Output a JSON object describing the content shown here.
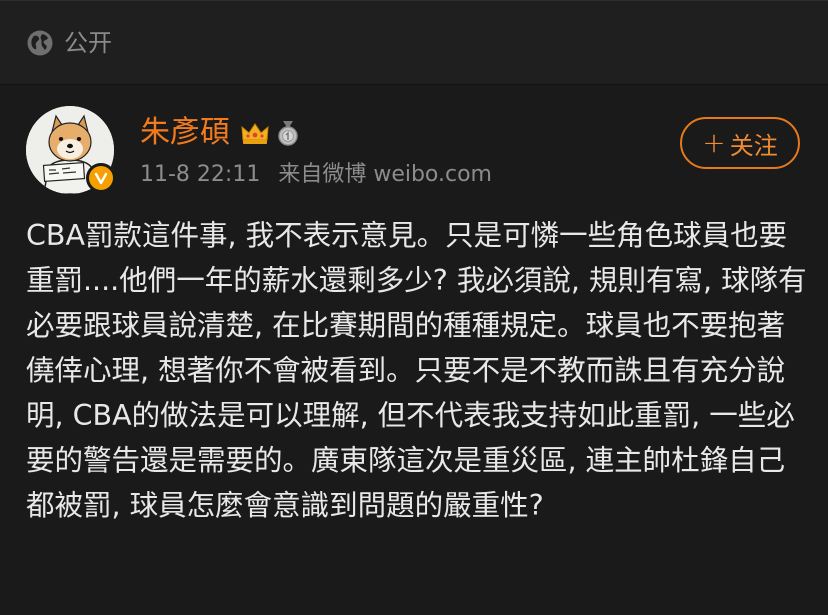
{
  "visibility": {
    "label": "公开",
    "icon": "globe-icon"
  },
  "post": {
    "author": {
      "name": "朱彥碩",
      "badges": [
        "crown-icon",
        "medal-icon"
      ],
      "verified": true,
      "avatar": "shiba-dog-avatar"
    },
    "meta": {
      "timestamp": "11-8 22:11",
      "source": "来自微博 weibo.com"
    },
    "follow_label": "关注",
    "body": "CBA罰款這件事, 我不表示意見。只是可憐一些角色球員也要重罰....他們一年的薪水還剩多少? 我必須說, 規則有寫, 球隊有必要跟球員說清楚, 在比賽期間的種種規定。球員也不要抱著僥倖心理, 想著你不會被看到。只要不是不教而誅且有充分說明, CBA的做法是可以理解, 但不代表我支持如此重罰, 一些必要的警告還是需要的。廣東隊這次是重災區, 連主帥杜鋒自己都被罰, 球員怎麼會意識到問題的嚴重性?"
  },
  "colors": {
    "background": "#1a1a1a",
    "username": "#f27b1e",
    "follow_border": "#e47a1a",
    "verified_badge": "#f5a000"
  }
}
